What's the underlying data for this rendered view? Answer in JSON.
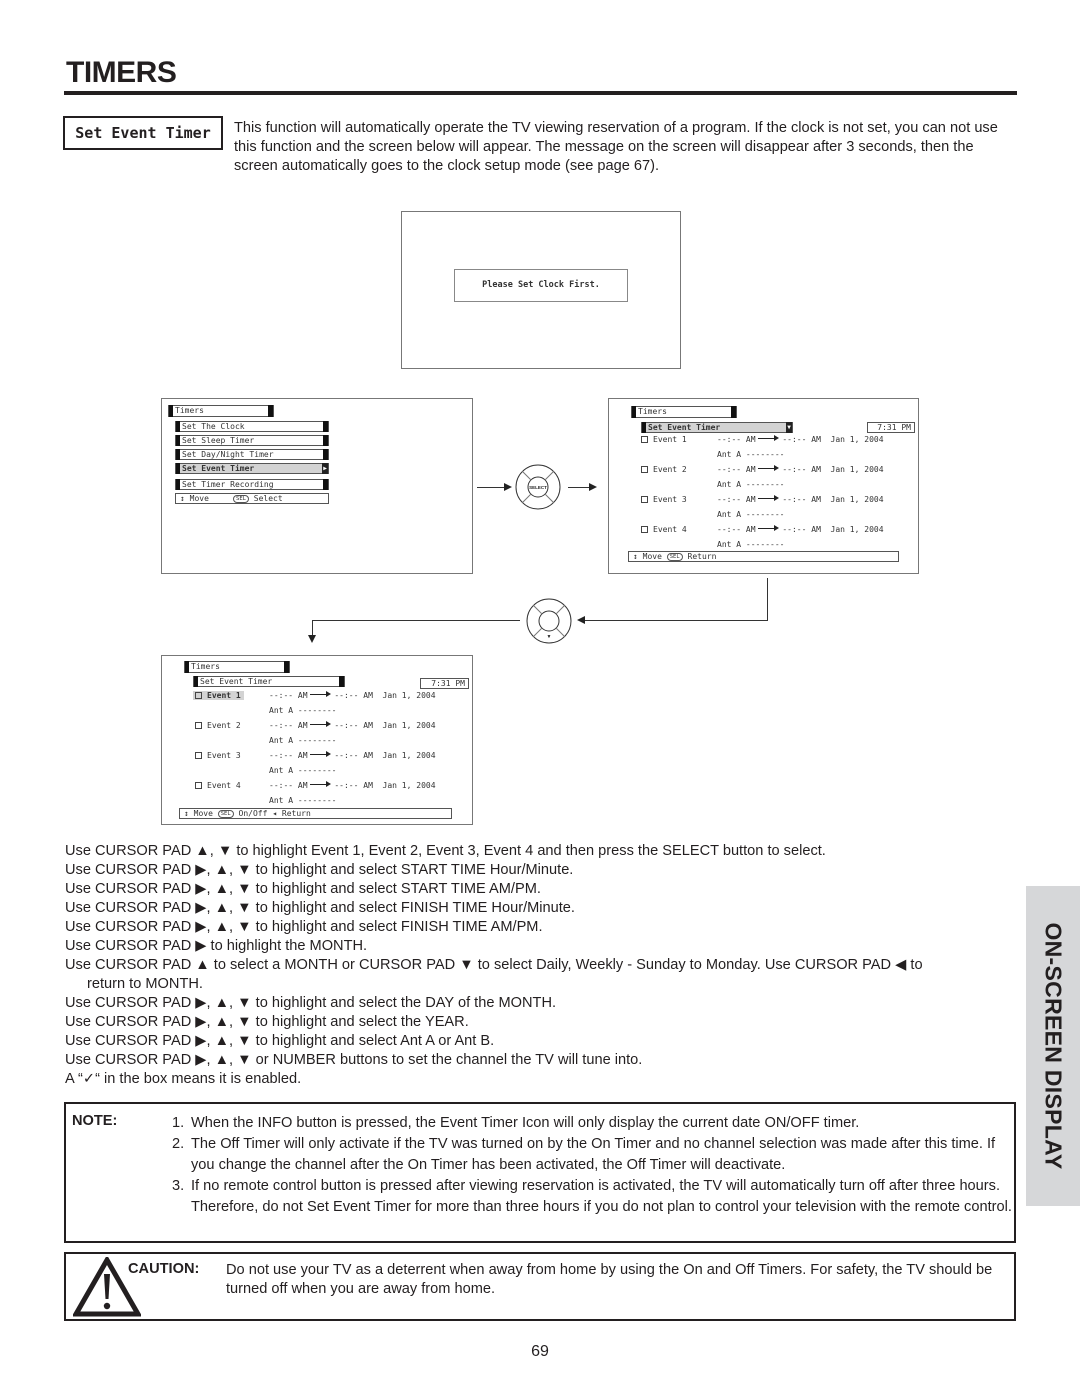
{
  "page": {
    "title": "TIMERS",
    "page_number": "69",
    "side_tab": "ON-SCREEN DISPLAY"
  },
  "section": {
    "label": "Set Event Timer",
    "intro": "This function will automatically operate the TV viewing reservation of a program.  If the clock is not set, you can not use this function and the screen below will appear.  The message on the screen will disappear after 3 seconds, then the screen automatically goes to the clock setup mode (see page 67)."
  },
  "clock_screen": {
    "message": "Please Set Clock First."
  },
  "menu_screen": {
    "header": "Timers",
    "items": [
      {
        "label": "Set The Clock",
        "selected": false
      },
      {
        "label": "Set Sleep Timer",
        "selected": false
      },
      {
        "label": "Set Day/Night Timer",
        "selected": false
      },
      {
        "label": "Set Event Timer",
        "selected": true
      },
      {
        "label": "Set Timer Recording",
        "selected": false
      }
    ],
    "footer": {
      "move": "Move",
      "sel_badge": "SEL",
      "action": "Select"
    }
  },
  "remote": {
    "select_label": "SELECT",
    "down_symbol": "▼"
  },
  "event_screen_a": {
    "header": "Timers",
    "subheader": "Set Event Timer",
    "clock": "7:31 PM",
    "events": [
      {
        "name": "Event 1",
        "start": "--:-- AM",
        "finish": "--:-- AM",
        "date": "Jan 1, 2004",
        "antenna": "Ant A",
        "channel": "--------",
        "enabled": false
      },
      {
        "name": "Event 2",
        "start": "--:-- AM",
        "finish": "--:-- AM",
        "date": "Jan 1, 2004",
        "antenna": "Ant A",
        "channel": "--------",
        "enabled": false
      },
      {
        "name": "Event 3",
        "start": "--:-- AM",
        "finish": "--:-- AM",
        "date": "Jan 1, 2004",
        "antenna": "Ant A",
        "channel": "--------",
        "enabled": false
      },
      {
        "name": "Event 4",
        "start": "--:-- AM",
        "finish": "--:-- AM",
        "date": "Jan 1, 2004",
        "antenna": "Ant A",
        "channel": "--------",
        "enabled": false
      }
    ],
    "footer": {
      "move": "Move",
      "sel_badge": "SEL",
      "action": "Return"
    }
  },
  "event_screen_b": {
    "header": "Timers",
    "subheader": "Set Event Timer",
    "clock": "7:31 PM",
    "highlighted_event": "Event 1",
    "events": [
      {
        "name": "Event 1",
        "start": "--:-- AM",
        "finish": "--:-- AM",
        "date": "Jan 1, 2004",
        "antenna": "Ant A",
        "channel": "--------",
        "enabled": false
      },
      {
        "name": "Event 2",
        "start": "--:-- AM",
        "finish": "--:-- AM",
        "date": "Jan 1, 2004",
        "antenna": "Ant A",
        "channel": "--------",
        "enabled": false
      },
      {
        "name": "Event 3",
        "start": "--:-- AM",
        "finish": "--:-- AM",
        "date": "Jan 1, 2004",
        "antenna": "Ant A",
        "channel": "--------",
        "enabled": false
      },
      {
        "name": "Event 4",
        "start": "--:-- AM",
        "finish": "--:-- AM",
        "date": "Jan 1, 2004",
        "antenna": "Ant A",
        "channel": "--------",
        "enabled": false
      }
    ],
    "footer": {
      "move": "Move",
      "sel_badge": "SEL",
      "action": "On/Off",
      "back_symbol": "◂",
      "back": "Return"
    }
  },
  "instructions": [
    "Use CURSOR PAD ▲, ▼ to highlight Event 1, Event 2, Event 3, Event 4 and then press the SELECT button to select.",
    "Use CURSOR PAD ▶, ▲, ▼ to highlight and select START TIME Hour/Minute.",
    "Use CURSOR PAD ▶, ▲, ▼ to highlight and select START TIME AM/PM.",
    "Use CURSOR PAD ▶, ▲, ▼ to highlight and select FINISH TIME Hour/Minute.",
    "Use CURSOR PAD ▶, ▲, ▼ to highlight and select FINISH TIME AM/PM.",
    "Use CURSOR PAD ▶ to highlight the MONTH.",
    "Use CURSOR PAD ▲ to select a MONTH or CURSOR PAD ▼ to select Daily, Weekly - Sunday to Monday.  Use CURSOR PAD ◀ to",
    "return to MONTH.",
    "Use CURSOR PAD ▶, ▲, ▼ to highlight and select the DAY of the MONTH.",
    "Use CURSOR PAD ▶, ▲, ▼ to highlight and select the YEAR.",
    "Use CURSOR PAD ▶, ▲, ▼ to highlight and select Ant A or Ant B.",
    "Use CURSOR PAD ▶, ▲, ▼ or NUMBER buttons to set the channel the TV will tune into.",
    "A “✓“ in the box means it is enabled."
  ],
  "note": {
    "label": "NOTE:",
    "items": [
      {
        "num": "1.",
        "text": "When the INFO button is pressed, the Event Timer Icon will only display the current date ON/OFF timer."
      },
      {
        "num": "2.",
        "text": "The Off Timer will only activate if the TV was turned on by the On Timer and no channel selection was made after this time.  If you change the channel after the On Timer has been activated, the Off Timer will deactivate."
      },
      {
        "num": "3.",
        "text": "If no remote control button is pressed after viewing reservation is activated, the TV will automatically turn off after three hours.  Therefore, do not Set Event Timer for more than three hours if you do not plan to control your television with the remote control."
      }
    ]
  },
  "caution": {
    "label": "CAUTION:",
    "icon": "warning-triangle-icon",
    "text": "Do not use your TV as a deterrent when away from home by using the On and Off Timers.  For safety, the TV should be turned off when you are away from home."
  }
}
